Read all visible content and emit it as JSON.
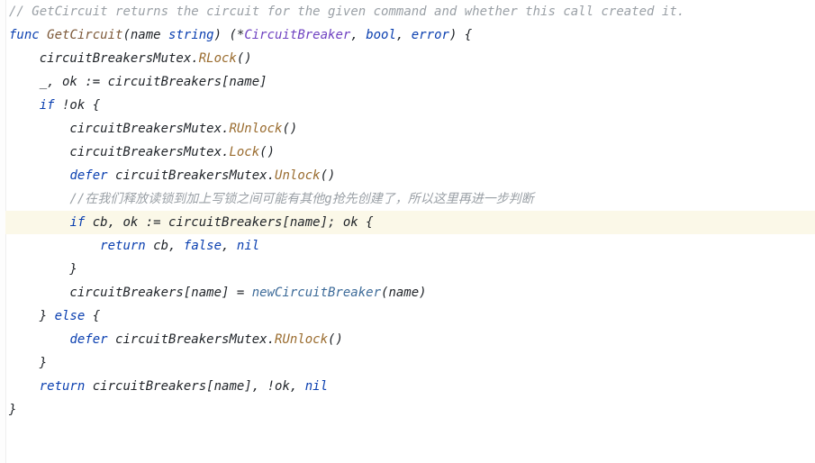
{
  "code": {
    "line1_comment_lead": "// ",
    "line1_comment_name": "GetCircuit",
    "line1_comment_rest": " returns the circuit for the given command and whether this call created it.",
    "line2_kw_func": "func",
    "line2_funcname": "GetCircuit",
    "line2_sig_open": "(name ",
    "line2_type_string": "string",
    "line2_sig_mid": ") (*",
    "line2_type_cb": "CircuitBreaker",
    "line2_sig_comma1": ", ",
    "line2_type_bool": "bool",
    "line2_sig_comma2": ", ",
    "line2_type_error": "error",
    "line2_sig_close": ") {",
    "line3_body": "    circuitBreakersMutex.",
    "line3_method": "RLock",
    "line3_tail": "()",
    "line4_body": "    _, ok := circuitBreakers[name]",
    "line5_indent": "    ",
    "line5_kw_if": "if",
    "line5_rest": " !ok {",
    "line6_body": "        circuitBreakersMutex.",
    "line6_method": "RUnlock",
    "line6_tail": "()",
    "line7_body": "        circuitBreakersMutex.",
    "line7_method": "Lock",
    "line7_tail": "()",
    "line8_indent": "        ",
    "line8_kw_defer": "defer",
    "line8_mid": " circuitBreakersMutex.",
    "line8_method": "Unlock",
    "line8_tail": "()",
    "line9_comment": "        //在我们释放读锁到加上写锁之间可能有其他g抢先创建了，所以这里再进一步判断",
    "line10_indent": "        ",
    "line10_kw_if": "if",
    "line10_rest": " cb, ok := circuitBreakers[name]; ok {",
    "line11_indent": "            ",
    "line11_kw_return": "return",
    "line11_mid": " cb, ",
    "line11_kw_false": "false",
    "line11_comma": ", ",
    "line11_kw_nil": "nil",
    "line12_body": "        }",
    "line13_body": "        circuitBreakers[name] = ",
    "line13_call": "newCircuitBreaker",
    "line13_tail": "(name)",
    "line14_body": "    } ",
    "line14_kw_else": "else",
    "line14_rest": " {",
    "line15_indent": "        ",
    "line15_kw_defer": "defer",
    "line15_mid": " circuitBreakersMutex.",
    "line15_method": "RUnlock",
    "line15_tail": "()",
    "line16_body": "    }",
    "line17_body": "",
    "line18_indent": "    ",
    "line18_kw_return": "return",
    "line18_mid": " circuitBreakers[name], !ok, ",
    "line18_kw_nil": "nil",
    "line19_body": "}"
  }
}
